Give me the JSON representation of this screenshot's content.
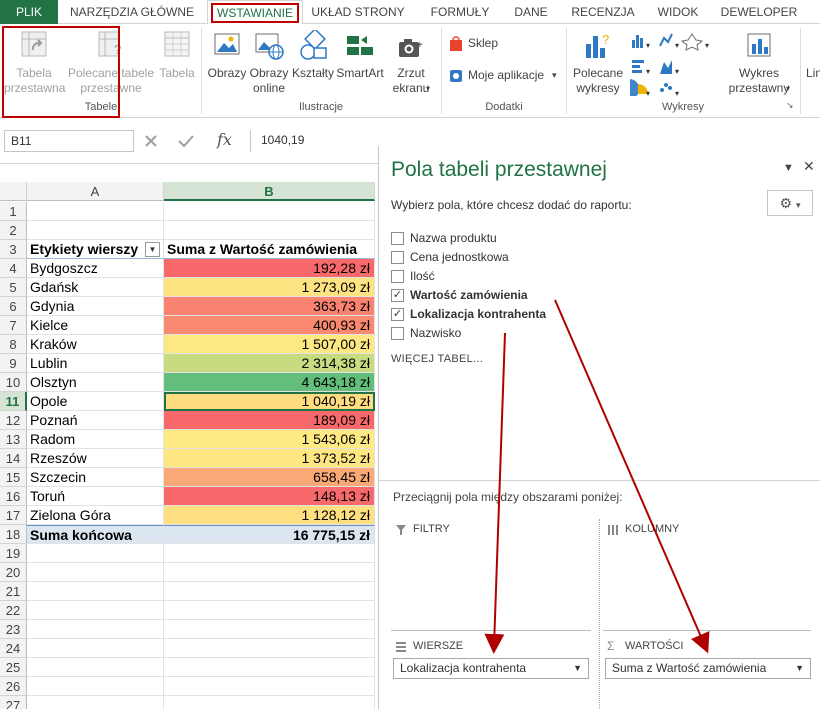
{
  "ribbon_tabs": [
    "PLIK",
    "NARZĘDZIA GŁÓWNE",
    "WSTAWIANIE",
    "UKŁAD STRONY",
    "FORMUŁY",
    "DANE",
    "RECENZJA",
    "WIDOK",
    "DEWELOPER"
  ],
  "ribbon": {
    "tabele": {
      "label": "Tabele",
      "btn1": [
        "Tabela",
        "przestawna"
      ],
      "btn2": [
        "Polecane tabele",
        "przestawne"
      ],
      "btn3": "Tabela"
    },
    "ilustracje": {
      "label": "Ilustracje",
      "obrazy": "Obrazy",
      "online": [
        "Obrazy",
        "online"
      ],
      "ksztalty": "Kształty",
      "smartart": "SmartArt",
      "zrzut": [
        "Zrzut",
        "ekranu"
      ]
    },
    "dodatki": {
      "label": "Dodatki",
      "sklep": "Sklep",
      "moje": "Moje aplikacje"
    },
    "wykresy": {
      "label": "Wykresy",
      "polecane": [
        "Polecane",
        "wykresy"
      ],
      "przestawny": [
        "Wykres",
        "przestawny"
      ]
    },
    "cut": "Lin"
  },
  "formula_bar": {
    "name_box": "B11",
    "fx": "fx",
    "value": "1040,19"
  },
  "grid": {
    "col_a": "A",
    "col_b": "B",
    "header": {
      "a": "Etykiety wierszy",
      "b": "Suma z Wartość zamówienia"
    },
    "rows": [
      {
        "label": "Bydgoszcz",
        "value": "192,28 zł",
        "color": "#f8696b"
      },
      {
        "label": "Gdańsk",
        "value": "1 273,09 zł",
        "color": "#fee382"
      },
      {
        "label": "Gdynia",
        "value": "363,73 zł",
        "color": "#f98370"
      },
      {
        "label": "Kielce",
        "value": "400,93 zł",
        "color": "#fa8971"
      },
      {
        "label": "Kraków",
        "value": "1 507,00 zł",
        "color": "#fee883"
      },
      {
        "label": "Lublin",
        "value": "2 314,38 zł",
        "color": "#c9db80"
      },
      {
        "label": "Olsztyn",
        "value": "4 643,18 zł",
        "color": "#63be7b"
      },
      {
        "label": "Opole",
        "value": "1 040,19 zł",
        "color": "#fedd81"
      },
      {
        "label": "Poznań",
        "value": "189,09 zł",
        "color": "#f8696b"
      },
      {
        "label": "Radom",
        "value": "1 543,06 zł",
        "color": "#fee983"
      },
      {
        "label": "Rzeszów",
        "value": "1 373,52 zł",
        "color": "#fee683"
      },
      {
        "label": "Szczecin",
        "value": "658,45 zł",
        "color": "#fba877"
      },
      {
        "label": "Toruń",
        "value": "148,13 zł",
        "color": "#f8696b"
      },
      {
        "label": "Zielona Góra",
        "value": "1 128,12 zł",
        "color": "#fedf81"
      }
    ],
    "total": {
      "a": "Suma końcowa",
      "b": "16 775,15 zł"
    },
    "row_numbers": [
      "1",
      "2",
      "3",
      "4",
      "5",
      "6",
      "7",
      "8",
      "9",
      "10",
      "11",
      "12",
      "13",
      "14",
      "15",
      "16",
      "17",
      "18",
      "19",
      "20",
      "21",
      "22",
      "23",
      "24",
      "25",
      "26",
      "27"
    ]
  },
  "pivot_pane": {
    "title": "Pola tabeli przestawnej",
    "subtitle": "Wybierz pola, które chcesz dodać do raportu:",
    "fields": [
      {
        "label": "Nazwa produktu",
        "checked": false
      },
      {
        "label": "Cena jednostkowa",
        "checked": false
      },
      {
        "label": "Ilość",
        "checked": false
      },
      {
        "label": "Wartość zamówienia",
        "checked": true
      },
      {
        "label": "Lokalizacja kontrahenta",
        "checked": true
      },
      {
        "label": "Nazwisko",
        "checked": false
      }
    ],
    "more_tables": "WIĘCEJ TABEL...",
    "drag_hint": "Przeciągnij pola między obszarami poniżej:",
    "areas": {
      "filters": "FILTRY",
      "columns": "KOLUMNY",
      "rows": "WIERSZE",
      "values": "WARTOŚCI"
    },
    "rows_value": "Lokalizacja kontrahenta",
    "values_value": "Suma z Wartość zamówienia"
  },
  "colors": {
    "accent": "#217346",
    "highlight": "#c00000",
    "total_bg": "#dce6f1"
  }
}
